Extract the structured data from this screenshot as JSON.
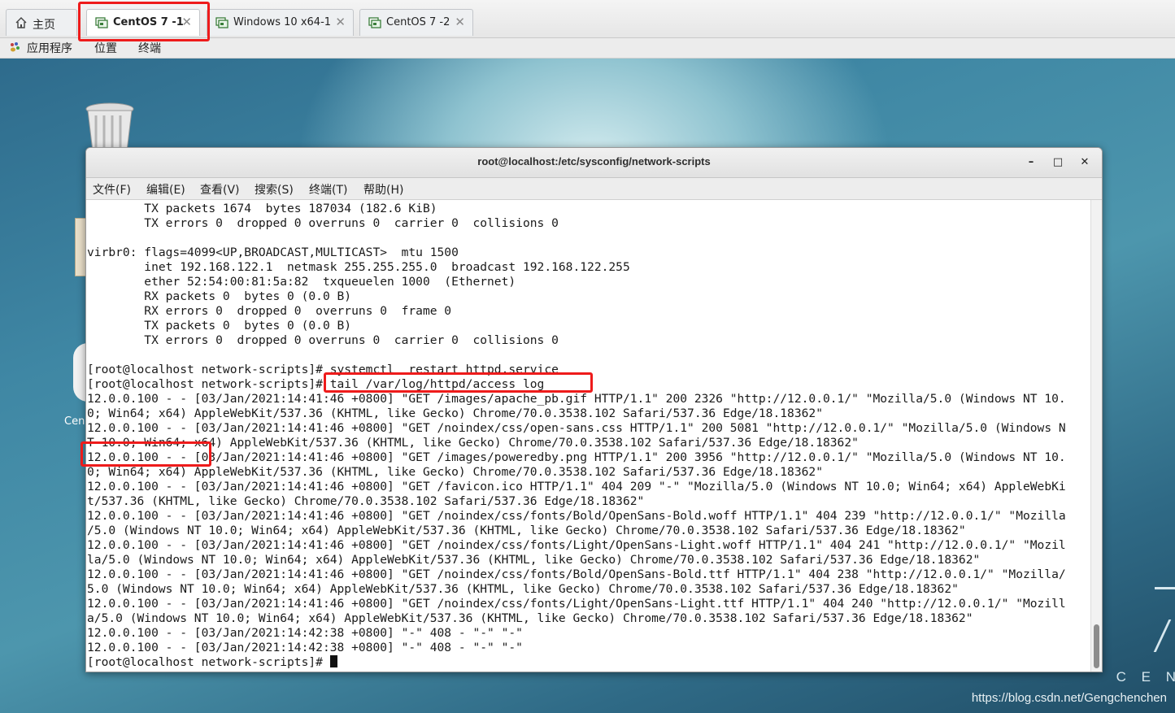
{
  "vm_tabs": [
    {
      "label": "主页",
      "active": false,
      "closable": false
    },
    {
      "label": "CentOS 7 -1",
      "active": true,
      "closable": true
    },
    {
      "label": "Windows 10 x64-1",
      "active": false,
      "closable": true
    },
    {
      "label": "CentOS 7 -2",
      "active": false,
      "closable": true
    }
  ],
  "tab_close_glyph": "✕",
  "gnome_menu": {
    "applications": "应用程序",
    "places": "位置",
    "terminal": "终端"
  },
  "desktop": {
    "icon_label_partial": "Cen",
    "logo_partial": "C E N",
    "watermark": "https://blog.csdn.net/Gengchenchen"
  },
  "terminal": {
    "title": "root@localhost:/etc/sysconfig/network-scripts",
    "controls": {
      "minimize": "–",
      "maximize": "□",
      "close": "✕"
    },
    "menu": [
      "文件(F)",
      "编辑(E)",
      "查看(V)",
      "搜索(S)",
      "终端(T)",
      "帮助(H)"
    ],
    "lines": [
      "        TX packets 1674  bytes 187034 (182.6 KiB)",
      "        TX errors 0  dropped 0 overruns 0  carrier 0  collisions 0",
      "",
      "virbr0: flags=4099<UP,BROADCAST,MULTICAST>  mtu 1500",
      "        inet 192.168.122.1  netmask 255.255.255.0  broadcast 192.168.122.255",
      "        ether 52:54:00:81:5a:82  txqueuelen 1000  (Ethernet)",
      "        RX packets 0  bytes 0 (0.0 B)",
      "        RX errors 0  dropped 0  overruns 0  frame 0",
      "        TX packets 0  bytes 0 (0.0 B)",
      "        TX errors 0  dropped 0 overruns 0  carrier 0  collisions 0",
      "",
      "[root@localhost network-scripts]# systemctl  restart httpd.service",
      "[root@localhost network-scripts]# tail /var/log/httpd/access_log",
      "12.0.0.100 - - [03/Jan/2021:14:41:46 +0800] \"GET /images/apache_pb.gif HTTP/1.1\" 200 2326 \"http://12.0.0.1/\" \"Mozilla/5.0 (Windows NT 10.",
      "0; Win64; x64) AppleWebKit/537.36 (KHTML, like Gecko) Chrome/70.0.3538.102 Safari/537.36 Edge/18.18362\"",
      "12.0.0.100 - - [03/Jan/2021:14:41:46 +0800] \"GET /noindex/css/open-sans.css HTTP/1.1\" 200 5081 \"http://12.0.0.1/\" \"Mozilla/5.0 (Windows N",
      "T 10.0; Win64; x64) AppleWebKit/537.36 (KHTML, like Gecko) Chrome/70.0.3538.102 Safari/537.36 Edge/18.18362\"",
      "12.0.0.100 - - [03/Jan/2021:14:41:46 +0800] \"GET /images/poweredby.png HTTP/1.1\" 200 3956 \"http://12.0.0.1/\" \"Mozilla/5.0 (Windows NT 10.",
      "0; Win64; x64) AppleWebKit/537.36 (KHTML, like Gecko) Chrome/70.0.3538.102 Safari/537.36 Edge/18.18362\"",
      "12.0.0.100 - - [03/Jan/2021:14:41:46 +0800] \"GET /favicon.ico HTTP/1.1\" 404 209 \"-\" \"Mozilla/5.0 (Windows NT 10.0; Win64; x64) AppleWebKi",
      "t/537.36 (KHTML, like Gecko) Chrome/70.0.3538.102 Safari/537.36 Edge/18.18362\"",
      "12.0.0.100 - - [03/Jan/2021:14:41:46 +0800] \"GET /noindex/css/fonts/Bold/OpenSans-Bold.woff HTTP/1.1\" 404 239 \"http://12.0.0.1/\" \"Mozilla",
      "/5.0 (Windows NT 10.0; Win64; x64) AppleWebKit/537.36 (KHTML, like Gecko) Chrome/70.0.3538.102 Safari/537.36 Edge/18.18362\"",
      "12.0.0.100 - - [03/Jan/2021:14:41:46 +0800] \"GET /noindex/css/fonts/Light/OpenSans-Light.woff HTTP/1.1\" 404 241 \"http://12.0.0.1/\" \"Mozil",
      "la/5.0 (Windows NT 10.0; Win64; x64) AppleWebKit/537.36 (KHTML, like Gecko) Chrome/70.0.3538.102 Safari/537.36 Edge/18.18362\"",
      "12.0.0.100 - - [03/Jan/2021:14:41:46 +0800] \"GET /noindex/css/fonts/Bold/OpenSans-Bold.ttf HTTP/1.1\" 404 238 \"http://12.0.0.1/\" \"Mozilla/",
      "5.0 (Windows NT 10.0; Win64; x64) AppleWebKit/537.36 (KHTML, like Gecko) Chrome/70.0.3538.102 Safari/537.36 Edge/18.18362\"",
      "12.0.0.100 - - [03/Jan/2021:14:41:46 +0800] \"GET /noindex/css/fonts/Light/OpenSans-Light.ttf HTTP/1.1\" 404 240 \"http://12.0.0.1/\" \"Mozill",
      "a/5.0 (Windows NT 10.0; Win64; x64) AppleWebKit/537.36 (KHTML, like Gecko) Chrome/70.0.3538.102 Safari/537.36 Edge/18.18362\"",
      "12.0.0.100 - - [03/Jan/2021:14:42:38 +0800] \"-\" 408 - \"-\" \"-\"",
      "12.0.0.100 - - [03/Jan/2021:14:42:38 +0800] \"-\" 408 - \"-\" \"-\""
    ],
    "prompt": "[root@localhost network-scripts]# "
  },
  "colors": {
    "highlight_red": "#ee1b1b",
    "desktop_blue": "#3f87a4"
  }
}
